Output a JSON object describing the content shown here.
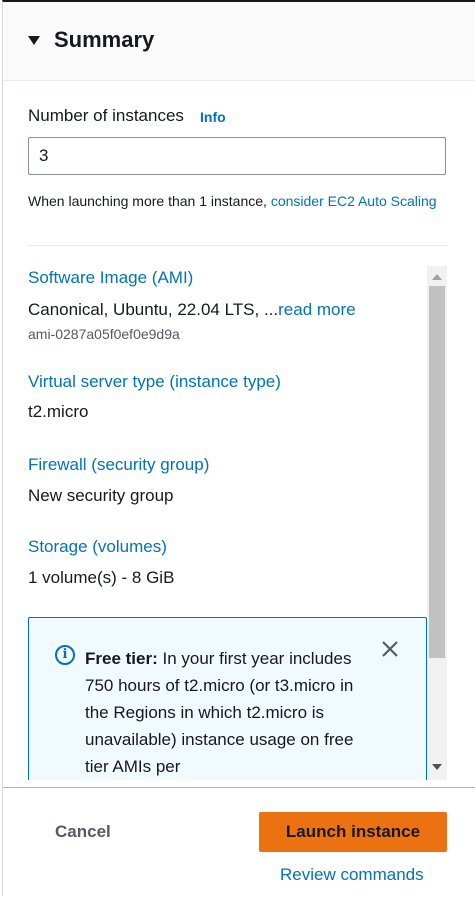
{
  "summary": {
    "title": "Summary"
  },
  "instances": {
    "label": "Number of instances",
    "info": "Info",
    "value": "3",
    "hint_prefix": "When launching more than 1 instance, ",
    "hint_link": "consider EC2 Auto Scaling"
  },
  "sections": {
    "ami": {
      "label": "Software Image (AMI)",
      "value": "Canonical, Ubuntu, 22.04 LTS, ...",
      "more": "read more",
      "id": "ami-0287a05f0ef0e9d9a"
    },
    "instance_type": {
      "label": "Virtual server type (instance type)",
      "value": "t2.micro"
    },
    "firewall": {
      "label": "Firewall (security group)",
      "value": "New security group"
    },
    "storage": {
      "label": "Storage (volumes)",
      "value": "1 volume(s) - 8 GiB"
    }
  },
  "free_tier": {
    "heading": "Free tier:",
    "text": " In your first year includes 750 hours of t2.micro (or t3.micro in the Regions in which t2.micro is unavailable) instance usage on free tier AMIs per"
  },
  "footer": {
    "cancel": "Cancel",
    "launch": "Launch instance",
    "review": "Review commands"
  },
  "colors": {
    "link": "#0073bb",
    "primary": "#ec7211"
  }
}
